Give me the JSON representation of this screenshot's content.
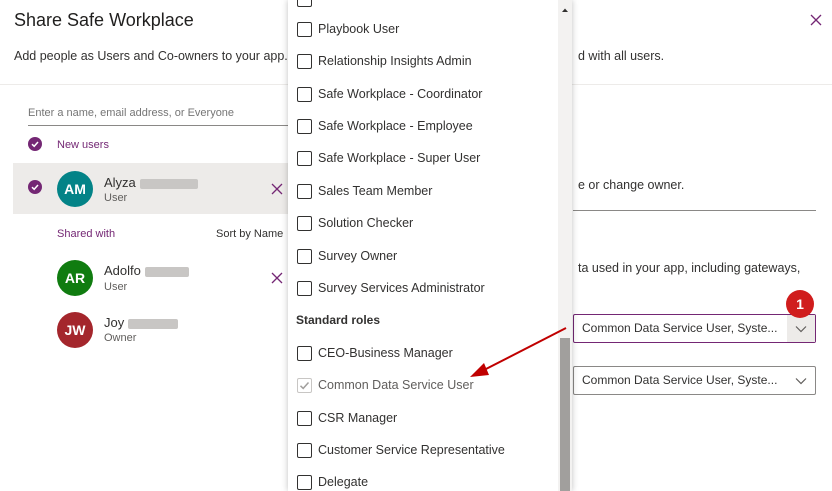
{
  "dialog": {
    "title": "Share Safe Workplace",
    "subtitle": "Add people as Users and Co-owners to your app.",
    "subtitle_tail": "d with all users."
  },
  "search": {
    "placeholder": "Enter a name, email address, or Everyone"
  },
  "new_users": {
    "label": "New users"
  },
  "users": {
    "alyza": {
      "initials": "AM",
      "first_name": "Alyza",
      "role": "User",
      "avatar_color": "#038387"
    },
    "adolfo": {
      "initials": "AR",
      "first_name": "Adolfo",
      "role": "User",
      "avatar_color": "#107c10"
    },
    "joy": {
      "initials": "JW",
      "first_name": "Joy",
      "role": "Owner",
      "avatar_color": "#a4262c"
    }
  },
  "shared_with": {
    "label": "Shared with",
    "sort_label": "Sort by Name"
  },
  "right_panel": {
    "co_owner_text": "e or change owner.",
    "data_text": "ta used in your app, including gateways,",
    "select_1_value": "Common Data Service User, Syste...",
    "select_2_value": "Common Data Service User, Syste...",
    "badge": "1"
  },
  "dropdown": {
    "items_top": [
      {
        "label": "Playbook User",
        "checked": false
      },
      {
        "label": "Relationship Insights Admin",
        "checked": false
      },
      {
        "label": "Safe Workplace - Coordinator",
        "checked": false
      },
      {
        "label": "Safe Workplace - Employee",
        "checked": false
      },
      {
        "label": "Safe Workplace - Super User",
        "checked": false
      },
      {
        "label": "Sales Team Member",
        "checked": false
      },
      {
        "label": "Solution Checker",
        "checked": false
      },
      {
        "label": "Survey Owner",
        "checked": false
      },
      {
        "label": "Survey Services Administrator",
        "checked": false
      }
    ],
    "group_standard": "Standard roles",
    "items_standard": [
      {
        "label": "CEO-Business Manager",
        "checked": false
      },
      {
        "label": "Common Data Service User",
        "checked": true
      },
      {
        "label": "CSR Manager",
        "checked": false
      },
      {
        "label": "Customer Service Representative",
        "checked": false
      },
      {
        "label": "Delegate",
        "checked": false
      }
    ]
  },
  "colors": {
    "accent": "#742774",
    "annotation_red": "#c00000"
  }
}
